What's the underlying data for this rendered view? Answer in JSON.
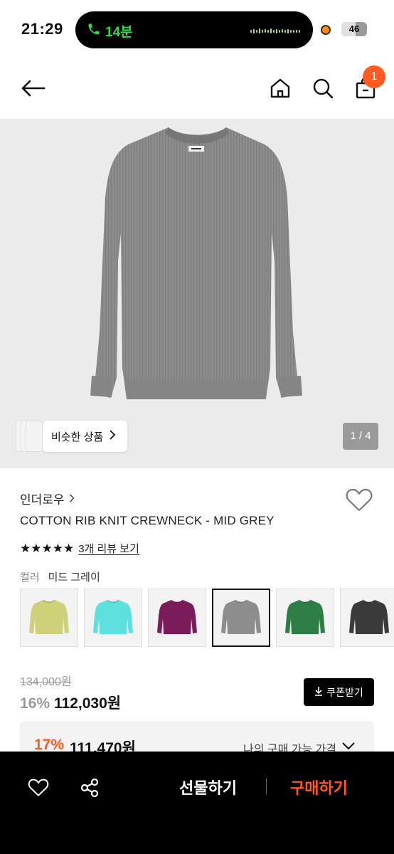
{
  "status": {
    "time": "21:29",
    "call_duration": "14분",
    "battery": "46"
  },
  "header": {
    "cart_count": "1"
  },
  "gallery": {
    "similar_label": "비슷한 상품",
    "pager": "1 / 4"
  },
  "product": {
    "brand": "인더로우",
    "title": "COTTON RIB KNIT CREWNECK - MID GREY",
    "stars": "★★★★★",
    "rating": 5,
    "review_link": "3개 리뷰 보기",
    "color_label": "컬러",
    "color_value": "미드 그레이",
    "swatches": [
      {
        "name": "yellow",
        "color": "#cfd07a"
      },
      {
        "name": "aqua",
        "color": "#5ee0de"
      },
      {
        "name": "purple",
        "color": "#7a1b5a"
      },
      {
        "name": "mid-grey",
        "color": "#8d8d8d",
        "selected": true
      },
      {
        "name": "green",
        "color": "#2e7d46"
      },
      {
        "name": "charcoal",
        "color": "#3a3a3a"
      }
    ]
  },
  "price": {
    "original": "134,000원",
    "discount_pct": "16%",
    "sale": "112,030원",
    "coupon_label": "쿠폰받기",
    "my_pct": "17%",
    "my_price": "111,470원",
    "my_label": "나의 구매 가능 가격"
  },
  "bottom_bar": {
    "gift_label": "선물하기",
    "buy_label": "구매하기"
  },
  "colors": {
    "accent": "#ff5a1f",
    "call_green": "#32d74b",
    "sweater_grey": "#8d8d8d"
  }
}
